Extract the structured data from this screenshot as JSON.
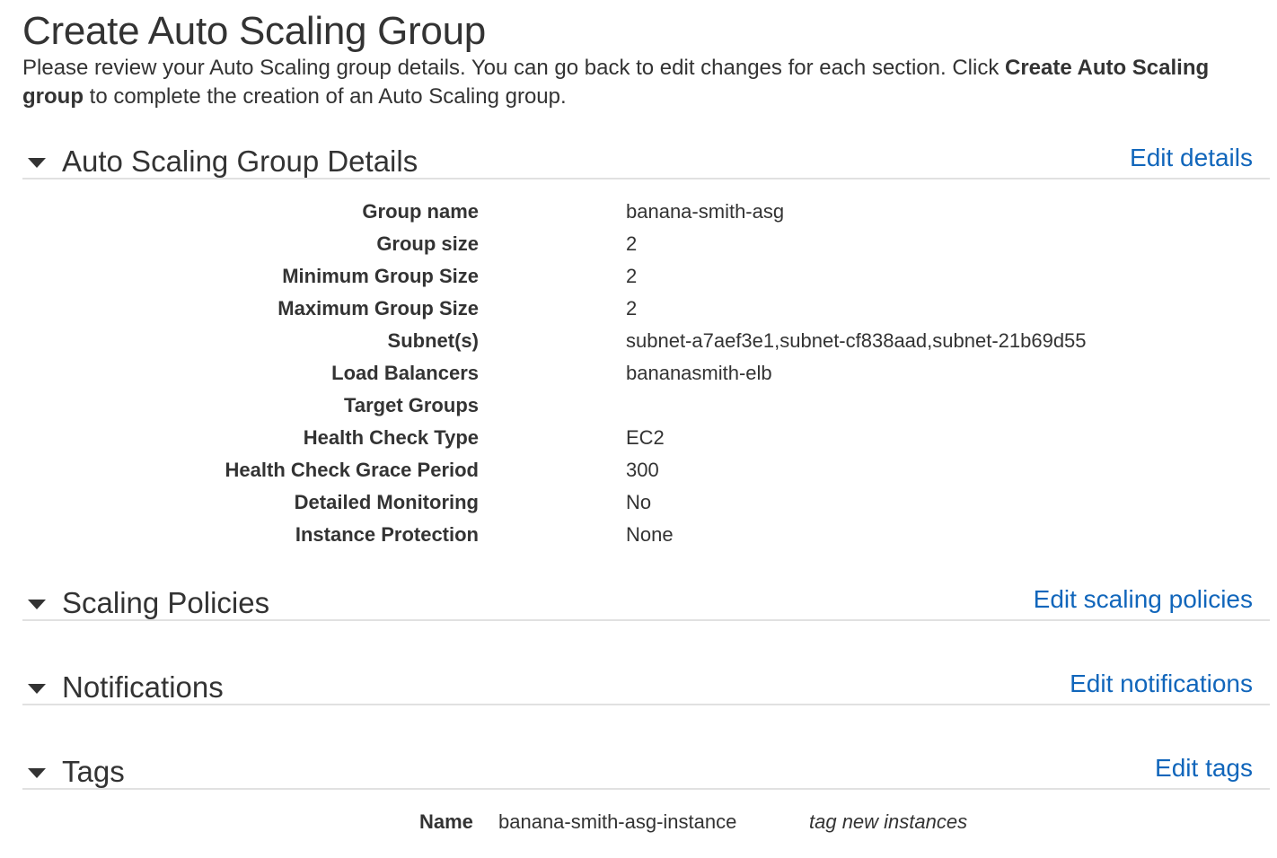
{
  "page": {
    "title": "Create Auto Scaling Group",
    "intro_before": "Please review your Auto Scaling group details. You can go back to edit changes for each section. Click ",
    "intro_bold": "Create Auto Scaling group",
    "intro_after": " to complete the creation of an Auto Scaling group."
  },
  "sections": {
    "details": {
      "title": "Auto Scaling Group Details",
      "edit_label": "Edit details"
    },
    "policies": {
      "title": "Scaling Policies",
      "edit_label": "Edit scaling policies"
    },
    "notifications": {
      "title": "Notifications",
      "edit_label": "Edit notifications"
    },
    "tags": {
      "title": "Tags",
      "edit_label": "Edit tags"
    }
  },
  "details": [
    {
      "label": "Group name",
      "value": "banana-smith-asg"
    },
    {
      "label": "Group size",
      "value": "2"
    },
    {
      "label": "Minimum Group Size",
      "value": "2"
    },
    {
      "label": "Maximum Group Size",
      "value": "2"
    },
    {
      "label": "Subnet(s)",
      "value": "subnet-a7aef3e1,subnet-cf838aad,subnet-21b69d55"
    },
    {
      "label": "Load Balancers",
      "value": "bananasmith-elb"
    },
    {
      "label": "Target Groups",
      "value": ""
    },
    {
      "label": "Health Check Type",
      "value": "EC2"
    },
    {
      "label": "Health Check Grace Period",
      "value": "300"
    },
    {
      "label": "Detailed Monitoring",
      "value": "No"
    },
    {
      "label": "Instance Protection",
      "value": "None"
    }
  ],
  "tags": [
    {
      "key": "Name",
      "value": "banana-smith-asg-instance",
      "note": "tag new instances"
    }
  ],
  "colors": {
    "link": "#1166bb",
    "text": "#333333",
    "divider": "#e1e1e1"
  }
}
